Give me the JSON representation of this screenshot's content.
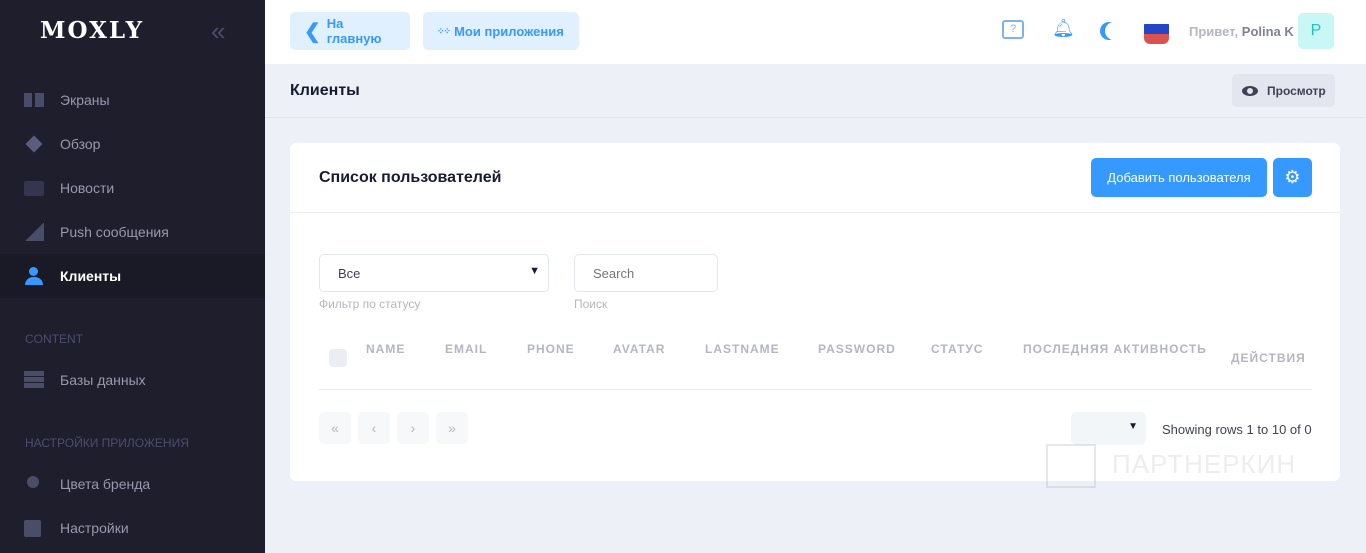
{
  "sidebar": {
    "logo": "MOXLY",
    "items": [
      {
        "label": "Экраны",
        "icon": "screens-icon"
      },
      {
        "label": "Обзор",
        "icon": "layers-icon"
      },
      {
        "label": "Новости",
        "icon": "news-icon"
      },
      {
        "label": "Push сообщения",
        "icon": "stairs-icon"
      },
      {
        "label": "Клиенты",
        "icon": "user-icon",
        "active": true
      },
      {
        "label": "Базы данных",
        "icon": "database-icon"
      },
      {
        "label": "Цвета бренда",
        "icon": "palette-icon"
      },
      {
        "label": "Настройки",
        "icon": "settings-square-icon"
      }
    ],
    "sections": [
      "CONTENT",
      "НАСТРОЙКИ ПРИЛОЖЕНИЯ"
    ]
  },
  "topbar": {
    "home": "На главную",
    "apps": "Мои приложения",
    "greeting": "Привет,",
    "user": "Polina K",
    "avatar_letter": "P"
  },
  "subheader": {
    "title": "Клиенты",
    "preview": "Просмотр"
  },
  "card": {
    "title": "Список пользователей",
    "add_button": "Добавить пользователя",
    "filter": {
      "value": "Все",
      "label": "Фильтр по статусу"
    },
    "search": {
      "placeholder": "Search",
      "label": "Поиск"
    },
    "columns": [
      "NAME",
      "EMAIL",
      "PHONE",
      "AVATAR",
      "LASTNAME",
      "PASSWORD",
      "СТАТУС",
      "ПОСЛЕДНЯЯ АКТИВНОСТЬ",
      "ДЕЙСТВИЯ"
    ],
    "pagination": {
      "first": "«",
      "prev": "‹",
      "next": "›",
      "last": "»",
      "info": "Showing rows 1 to 10 of 0"
    }
  },
  "watermark": "ПАРТНЕРКИН",
  "colors": {
    "primary": "#3699ff",
    "sidebar": "#1e1e2d"
  }
}
